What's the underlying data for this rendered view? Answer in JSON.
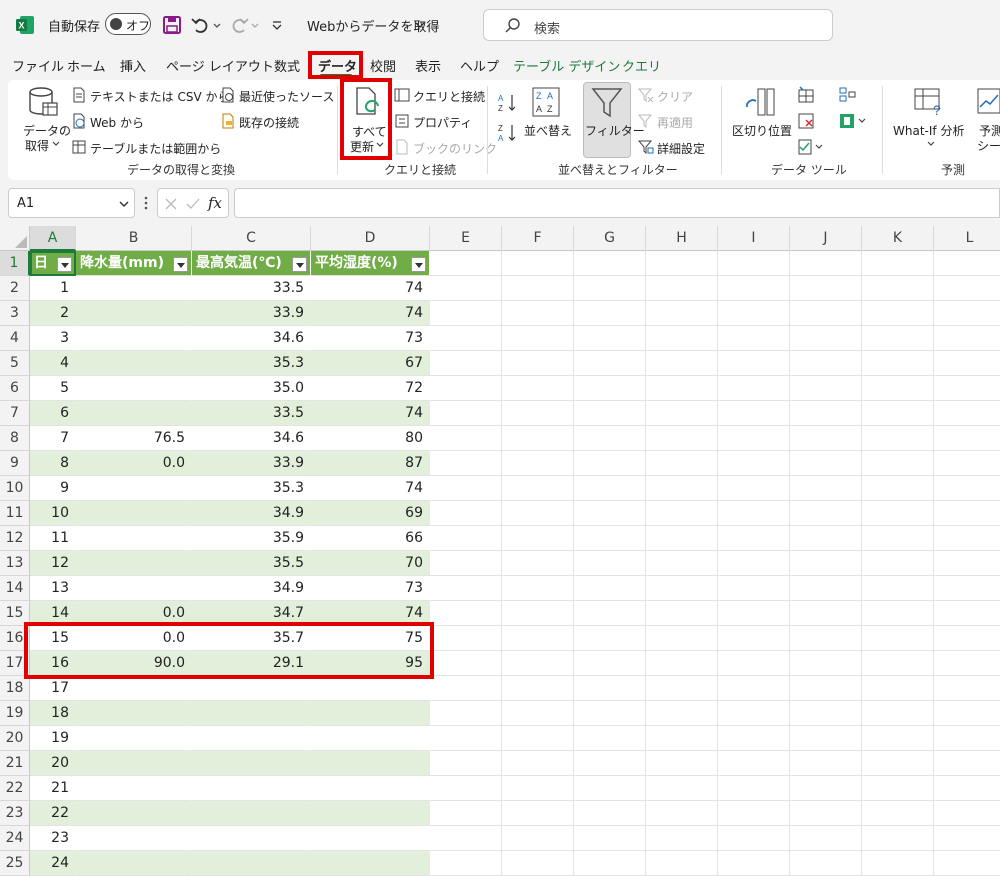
{
  "titlebar": {
    "autosave_label": "自動保存",
    "autosave_state": "オフ",
    "document_title": "Webからデータを取得",
    "search_placeholder": "検索"
  },
  "tabs": [
    {
      "label": "ファイル"
    },
    {
      "label": "ホーム"
    },
    {
      "label": "挿入"
    },
    {
      "label": "ページ レイアウト"
    },
    {
      "label": "数式"
    },
    {
      "label": "データ",
      "active": true
    },
    {
      "label": "校閲"
    },
    {
      "label": "表示"
    },
    {
      "label": "ヘルプ"
    },
    {
      "label": "テーブル デザイン",
      "contextual": true
    },
    {
      "label": "クエリ",
      "contextual": true
    }
  ],
  "ribbon": {
    "get_data_1": "データの",
    "get_data_2": "取得",
    "text_csv": "テキストまたは CSV から",
    "web": "Web から",
    "table_range": "テーブルまたは範囲から",
    "recent_sources": "最近使ったソース",
    "existing_connections": "既存の接続",
    "group_get_transform": "データの取得と変換",
    "refresh_all_1": "すべて",
    "refresh_all_2": "更新",
    "queries_connections": "クエリと接続",
    "properties": "プロパティ",
    "edit_links": "ブックのリンク",
    "group_queries": "クエリと接続",
    "sort": "並べ替え",
    "filter": "フィルター",
    "clear": "クリア",
    "reapply": "再適用",
    "advanced": "詳細設定",
    "group_sort_filter": "並べ替えとフィルター",
    "text_to_columns": "区切り位置",
    "group_data_tools": "データ ツール",
    "whatif": "What-If 分析",
    "forecast_1": "予測",
    "forecast_2": "シー",
    "group_forecast": "予測"
  },
  "formula_bar": {
    "name_box": "A1",
    "fx": "fx",
    "formula": ""
  },
  "grid": {
    "columns": [
      "A",
      "B",
      "C",
      "D",
      "E",
      "F",
      "G",
      "H",
      "I",
      "J",
      "K",
      "L"
    ],
    "table_headers": [
      "日",
      "降水量(mm)",
      "最高気温(℃)",
      "平均湿度(%)"
    ],
    "rows": [
      {
        "row": "1"
      },
      {
        "row": "2",
        "day": "1",
        "rain": "",
        "temp": "33.5",
        "humid": "74"
      },
      {
        "row": "3",
        "day": "2",
        "rain": "",
        "temp": "33.9",
        "humid": "74"
      },
      {
        "row": "4",
        "day": "3",
        "rain": "",
        "temp": "34.6",
        "humid": "73"
      },
      {
        "row": "5",
        "day": "4",
        "rain": "",
        "temp": "35.3",
        "humid": "67"
      },
      {
        "row": "6",
        "day": "5",
        "rain": "",
        "temp": "35.0",
        "humid": "72"
      },
      {
        "row": "7",
        "day": "6",
        "rain": "",
        "temp": "33.5",
        "humid": "74"
      },
      {
        "row": "8",
        "day": "7",
        "rain": "76.5",
        "temp": "34.6",
        "humid": "80"
      },
      {
        "row": "9",
        "day": "8",
        "rain": "0.0",
        "temp": "33.9",
        "humid": "87"
      },
      {
        "row": "10",
        "day": "9",
        "rain": "",
        "temp": "35.3",
        "humid": "74"
      },
      {
        "row": "11",
        "day": "10",
        "rain": "",
        "temp": "34.9",
        "humid": "69"
      },
      {
        "row": "12",
        "day": "11",
        "rain": "",
        "temp": "35.9",
        "humid": "66"
      },
      {
        "row": "13",
        "day": "12",
        "rain": "",
        "temp": "35.5",
        "humid": "70"
      },
      {
        "row": "14",
        "day": "13",
        "rain": "",
        "temp": "34.9",
        "humid": "73"
      },
      {
        "row": "15",
        "day": "14",
        "rain": "0.0",
        "temp": "34.7",
        "humid": "74"
      },
      {
        "row": "16",
        "day": "15",
        "rain": "0.0",
        "temp": "35.7",
        "humid": "75"
      },
      {
        "row": "17",
        "day": "16",
        "rain": "90.0",
        "temp": "29.1",
        "humid": "95"
      },
      {
        "row": "18",
        "day": "17",
        "rain": "",
        "temp": "",
        "humid": ""
      },
      {
        "row": "19",
        "day": "18",
        "rain": "",
        "temp": "",
        "humid": ""
      },
      {
        "row": "20",
        "day": "19",
        "rain": "",
        "temp": "",
        "humid": ""
      },
      {
        "row": "21",
        "day": "20",
        "rain": "",
        "temp": "",
        "humid": ""
      },
      {
        "row": "22",
        "day": "21",
        "rain": "",
        "temp": "",
        "humid": ""
      },
      {
        "row": "23",
        "day": "22",
        "rain": "",
        "temp": "",
        "humid": ""
      },
      {
        "row": "24",
        "day": "23",
        "rain": "",
        "temp": "",
        "humid": ""
      },
      {
        "row": "25",
        "day": "24",
        "rain": "",
        "temp": "",
        "humid": ""
      }
    ]
  },
  "colors": {
    "table_header": "#70ad47",
    "band": "#e2efda",
    "accent": "#1e7a3a",
    "highlight": "#e00000"
  }
}
